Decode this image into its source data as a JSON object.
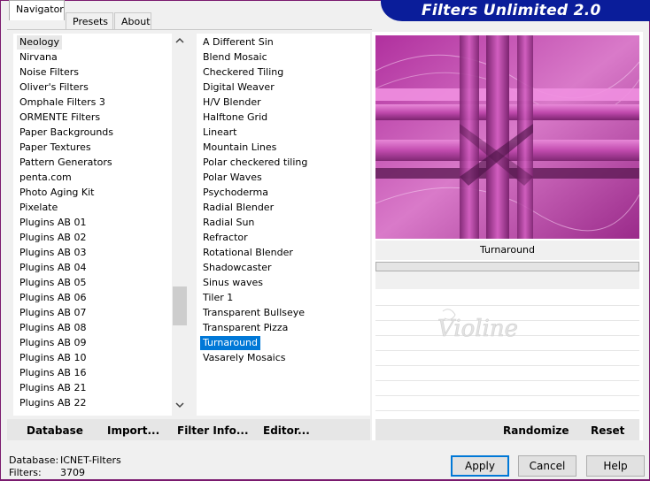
{
  "window": {
    "title": "Filters Unlimited 2.0"
  },
  "tabs": [
    {
      "label": "Navigator"
    },
    {
      "label": "Presets"
    },
    {
      "label": "About"
    }
  ],
  "categories": [
    "Neology",
    "Nirvana",
    "Noise Filters",
    "Oliver's Filters",
    "Omphale Filters 3",
    "ORMENTE Filters",
    "Paper Backgrounds",
    "Paper Textures",
    "Pattern Generators",
    "penta.com",
    "Photo Aging Kit",
    "Pixelate",
    "Plugins AB 01",
    "Plugins AB 02",
    "Plugins AB 03",
    "Plugins AB 04",
    "Plugins AB 05",
    "Plugins AB 06",
    "Plugins AB 07",
    "Plugins AB 08",
    "Plugins AB 09",
    "Plugins AB 10",
    "Plugins AB 16",
    "Plugins AB 21",
    "Plugins AB 22"
  ],
  "filters": [
    "A Different Sin",
    "Blend Mosaic",
    "Checkered Tiling",
    "Digital Weaver",
    "H/V Blender",
    "Halftone Grid",
    "Lineart",
    "Mountain Lines",
    "Polar checkered tiling",
    "Polar Waves",
    "Psychoderma",
    "Radial Blender",
    "Radial Sun",
    "Refractor",
    "Rotational Blender",
    "Shadowcaster",
    "Sinus waves",
    "Tiler 1",
    "Transparent Bullseye",
    "Transparent Pizza",
    "Turnaround",
    "Vasarely Mosaics"
  ],
  "selected_filter": "Turnaround",
  "current_category": "Neology",
  "left_buttons": {
    "database": "Database",
    "import": "Import...",
    "filter_info": "Filter Info...",
    "editor": "Editor..."
  },
  "preview": {
    "caption": "Turnaround"
  },
  "right_buttons": {
    "randomize": "Randomize",
    "reset": "Reset"
  },
  "status": {
    "database_label": "Database:",
    "database_value": "ICNET-Filters",
    "filters_label": "Filters:",
    "filters_value": "3709"
  },
  "dialog_buttons": {
    "apply": "Apply",
    "cancel": "Cancel",
    "help": "Help"
  },
  "colors": {
    "banner": "#0a1d9a",
    "selection": "#0078d7",
    "frame": "#7a1a6e",
    "preview_magenta": "#c040b0"
  },
  "icons": {
    "scroll_up": "chevron-up-icon",
    "scroll_down": "chevron-down-icon"
  }
}
